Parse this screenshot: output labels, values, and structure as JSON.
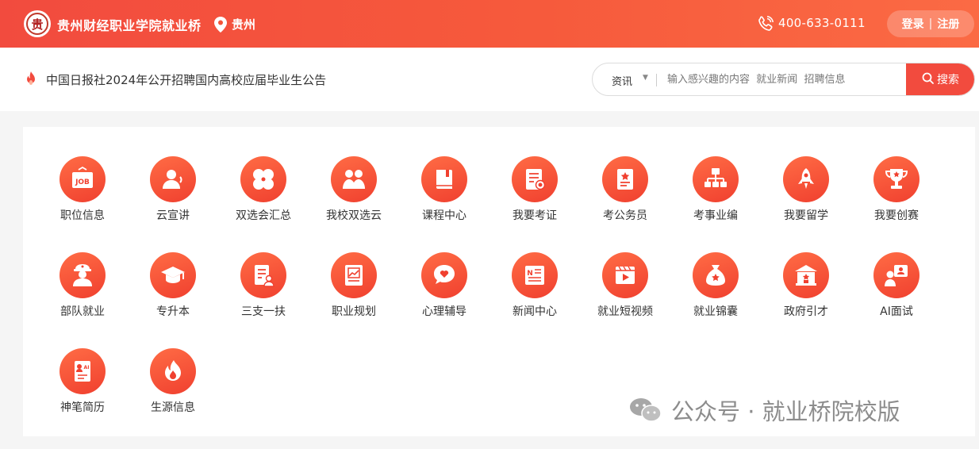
{
  "header": {
    "logo_char": "贵",
    "site_name": "贵州财经职业学院就业桥",
    "location": "贵州",
    "phone": "400-633-0111",
    "login": "登录",
    "sep": "|",
    "register": "注册"
  },
  "search": {
    "notice": "中国日报社2024年公开招聘国内高校应届毕业生公告",
    "type": "资讯",
    "placeholder": "输入感兴趣的内容  就业新闻  招聘信息",
    "button": "搜索"
  },
  "tiles": [
    {
      "label": "职位信息",
      "icon": "job-icon"
    },
    {
      "label": "云宣讲",
      "icon": "presenter-icon"
    },
    {
      "label": "双选会汇总",
      "icon": "clover-icon"
    },
    {
      "label": "我校双选云",
      "icon": "people-icon"
    },
    {
      "label": "课程中心",
      "icon": "book-icon"
    },
    {
      "label": "我要考证",
      "icon": "certificate-icon"
    },
    {
      "label": "考公务员",
      "icon": "document-star-icon"
    },
    {
      "label": "考事业编",
      "icon": "org-chart-icon"
    },
    {
      "label": "我要留学",
      "icon": "rocket-icon"
    },
    {
      "label": "我要创赛",
      "icon": "trophy-icon"
    },
    {
      "label": "部队就业",
      "icon": "soldier-icon"
    },
    {
      "label": "专升本",
      "icon": "graduation-cap-icon"
    },
    {
      "label": "三支一扶",
      "icon": "resume-person-icon"
    },
    {
      "label": "职业规划",
      "icon": "chart-board-icon"
    },
    {
      "label": "心理辅导",
      "icon": "heart-chat-icon"
    },
    {
      "label": "新闻中心",
      "icon": "newspaper-icon"
    },
    {
      "label": "就业短视频",
      "icon": "video-icon"
    },
    {
      "label": "就业锦囊",
      "icon": "money-bag-icon"
    },
    {
      "label": "政府引才",
      "icon": "government-icon"
    },
    {
      "label": "AI面试",
      "icon": "ai-interview-icon"
    },
    {
      "label": "神笔简历",
      "icon": "ai-resume-icon"
    },
    {
      "label": "生源信息",
      "icon": "flame-icon"
    }
  ],
  "watermark": {
    "text": "公众号 · 就业桥院校版"
  }
}
